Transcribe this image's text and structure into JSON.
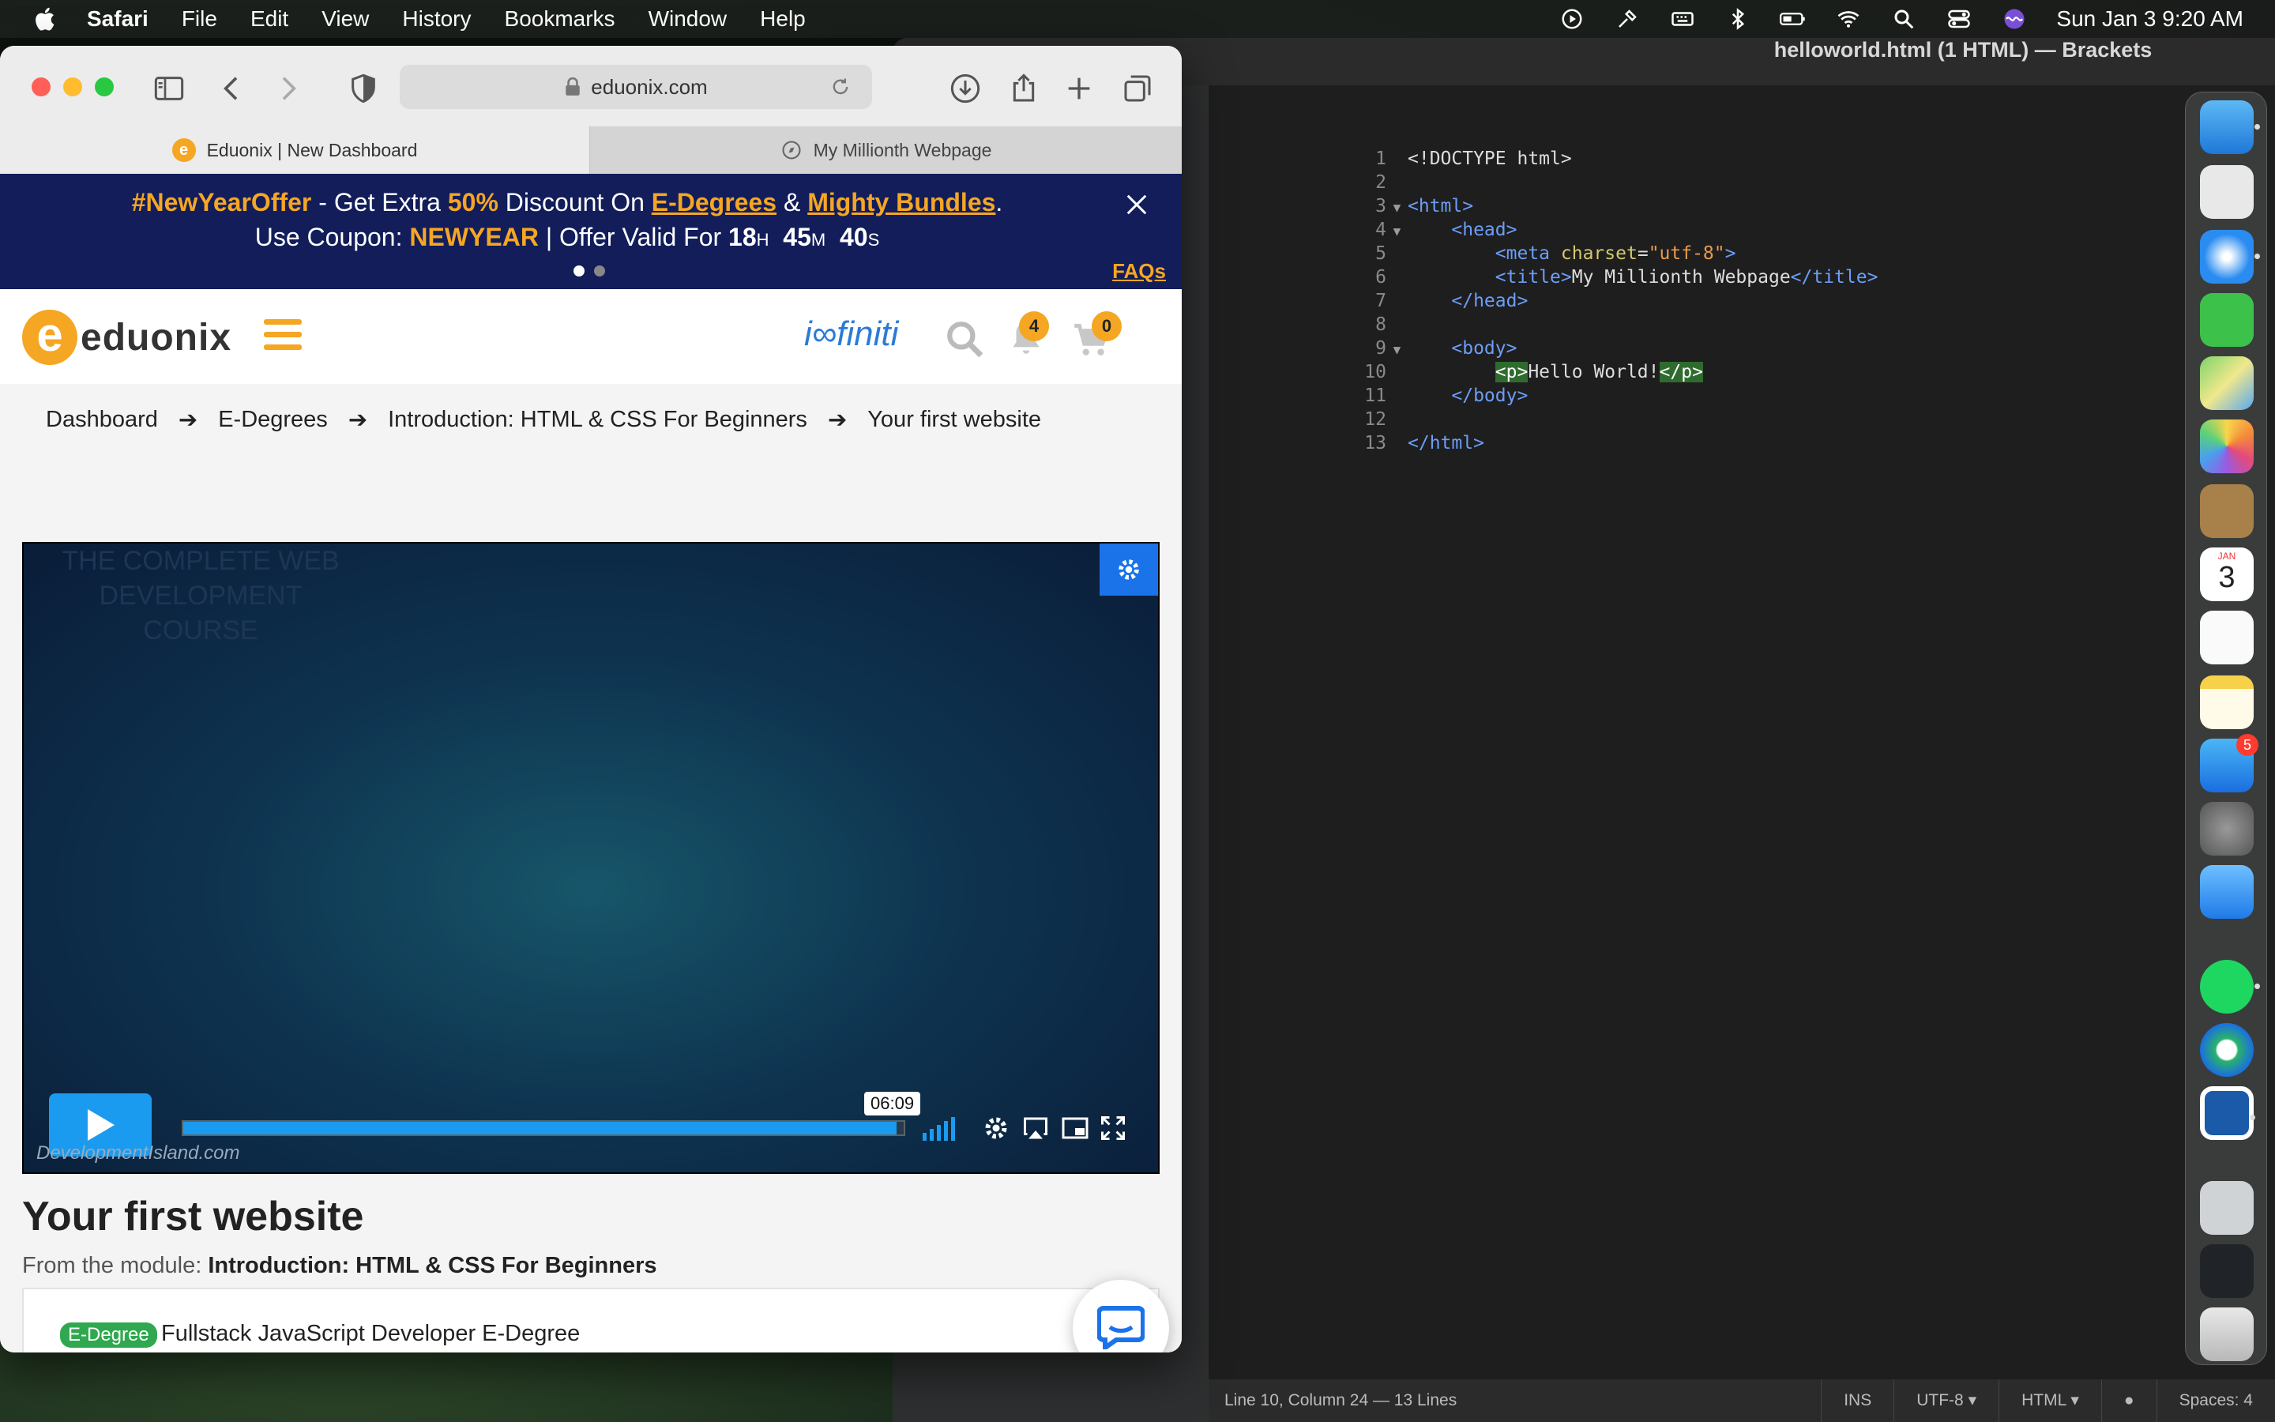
{
  "menubar": {
    "app": "Safari",
    "items": [
      "File",
      "Edit",
      "View",
      "History",
      "Bookmarks",
      "Window",
      "Help"
    ],
    "clock": "Sun Jan 3  9:20 AM"
  },
  "brackets": {
    "title": "helloworld.html (1 HTML) — Brackets",
    "lines": [
      {
        "n": "1",
        "code": "<!DOCTYPE html>"
      },
      {
        "n": "2",
        "code": ""
      },
      {
        "n": "3",
        "code": "<html>"
      },
      {
        "n": "4",
        "code": "    <head>"
      },
      {
        "n": "5",
        "code": "        <meta charset=\"utf-8\">"
      },
      {
        "n": "6",
        "code": "        <title>My Millionth Webpage</title>"
      },
      {
        "n": "7",
        "code": "    </head>"
      },
      {
        "n": "8",
        "code": ""
      },
      {
        "n": "9",
        "code": "    <body>"
      },
      {
        "n": "10",
        "code": "        <p>Hello World!</p>"
      },
      {
        "n": "11",
        "code": "    </body>"
      },
      {
        "n": "12",
        "code": ""
      },
      {
        "n": "13",
        "code": "</html>"
      }
    ],
    "status": {
      "cursor": "Line 10, Column 24",
      "lines": "— 13 Lines",
      "mode": "INS",
      "encoding": "UTF-8",
      "language": "HTML",
      "spaces": "Spaces: 4"
    }
  },
  "dock": {
    "appstore_badge": "5",
    "calendar_month": "JAN",
    "calendar_day": "3"
  },
  "safari": {
    "address": "eduonix.com",
    "tabs": [
      "Eduonix | New Dashboard",
      "My Millionth Webpage"
    ],
    "promo": {
      "hashtag": "#NewYearOffer",
      "get_extra": " - Get Extra ",
      "discount": "50%",
      "discount_on": " Discount On ",
      "edegrees": "E-Degrees",
      "amp": " & ",
      "bundles": "Mighty Bundles",
      "period": ".",
      "use_coupon": "Use Coupon: ",
      "coupon": "NEWYEAR",
      "valid": " | Offer Valid For ",
      "hours": "18",
      "h": "H",
      "minutes": "45",
      "m": "M",
      "seconds": "40",
      "s": "S",
      "faq": "FAQs"
    },
    "header": {
      "logo_letter": "e",
      "logo_word": "eduonix",
      "infiniti": "i∞finiti",
      "notifications": "4",
      "cart": "0"
    },
    "breadcrumb": [
      "Dashboard",
      "E-Degrees",
      "Introduction: HTML & CSS For Beginners",
      "Your first website"
    ],
    "video": {
      "watermark": "THE COMPLETE WEB DEVELOPMENT COURSE",
      "time": "06:09",
      "progress": 0.99,
      "credit": "DevelopmentIsland.com"
    },
    "lesson": {
      "title": "Your first website",
      "module_prefix": "From the module: ",
      "module_name": "Introduction: HTML & CSS For Beginners",
      "badge": "E-Degree",
      "edegree": "Fullstack JavaScript Developer E-Degree"
    }
  }
}
